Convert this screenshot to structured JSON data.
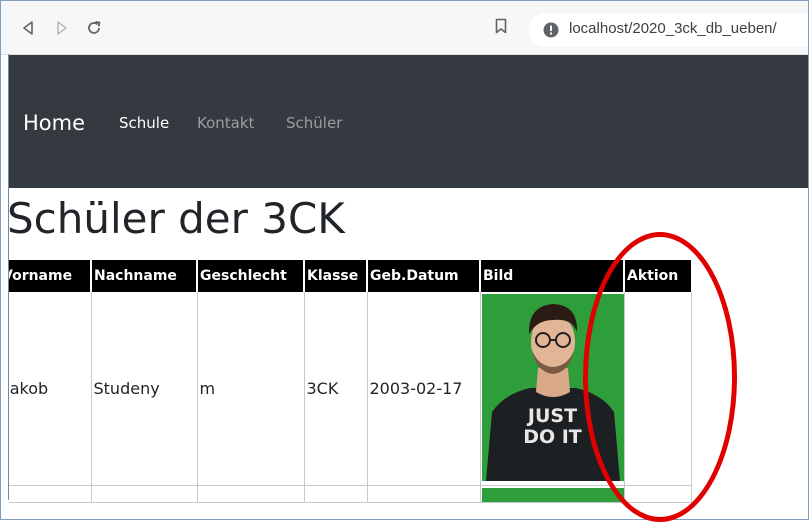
{
  "browser": {
    "url": "localhost/2020_3ck_db_ueben/"
  },
  "navbar": {
    "brand": "Home",
    "links": [
      {
        "label": "Schule",
        "active": true
      },
      {
        "label": "Kontakt",
        "active": false
      },
      {
        "label": "Schüler",
        "active": false
      }
    ]
  },
  "page": {
    "title": "Schüler der 3CK"
  },
  "table": {
    "headers": [
      "Vorname",
      "Nachname",
      "Geschlecht",
      "Klasse",
      "Geb.Datum",
      "Bild",
      "Aktion"
    ],
    "rows": [
      {
        "vorname": "Jakob",
        "nachname": "Studeny",
        "geschlecht": "m",
        "klasse": "3CK",
        "geb_datum": "2003-02-17",
        "shirt_text": "JUST DO IT"
      }
    ]
  },
  "colors": {
    "navbar_bg": "#343a40",
    "header_bg": "#000000",
    "photo_bg": "#2e9e3a",
    "annotation_circle": "#e00000"
  }
}
